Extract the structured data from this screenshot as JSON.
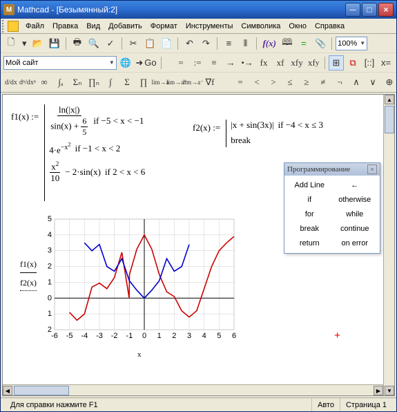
{
  "title": "Mathcad - [Безымянный:2]",
  "menu": [
    "Файл",
    "Правка",
    "Вид",
    "Добавить",
    "Формат",
    "Инструменты",
    "Символика",
    "Окно",
    "Справка"
  ],
  "toolbar2": {
    "site_label": "Мой сайт",
    "go": "Go"
  },
  "zoom": "100%",
  "status": {
    "hint": "Для справки нажмите F1",
    "mode": "Авто",
    "page": "Страница 1"
  },
  "programming": {
    "title": "Программирование",
    "items": [
      "Add Line",
      "←",
      "if",
      "otherwise",
      "for",
      "while",
      "break",
      "continue",
      "return",
      "on error"
    ]
  },
  "formulas": {
    "f1_lhs": "f1(x) :=",
    "f1_r1_num": "ln(|x|)",
    "f1_r1_den_a": "sin(x) + ",
    "f1_r1_den_frac_num": "6",
    "f1_r1_den_frac_den": "5",
    "f1_r1_cond": "if  −5 < x < −1",
    "f1_r2_a": "4·e",
    "f1_r2_exp": "−x",
    "f1_r2_exp2": "2",
    "f1_r2_cond": "if  −1 < x < 2",
    "f1_r3_frac_num": "x",
    "f1_r3_frac_num_exp": "2",
    "f1_r3_frac_den": "10",
    "f1_r3_b": " − 2·sin(x)",
    "f1_r3_cond": "if  2 < x < 6",
    "f2_lhs": "f2(x) :=",
    "f2_r1": "|x + sin(3x)|",
    "f2_r1_cond": "if  −4 < x ≤ 3",
    "f2_r2": "break",
    "plot_y1": "f1(x)",
    "plot_y2": "f2(x)",
    "plot_x": "x"
  },
  "chart_data": {
    "type": "line",
    "xlabel": "x",
    "ylabel": "",
    "xlim": [
      -6,
      6
    ],
    "ylim": [
      -2,
      5
    ],
    "xticks": [
      -6,
      -5,
      -4,
      -3,
      -2,
      -1,
      0,
      1,
      2,
      3,
      4,
      5,
      6
    ],
    "yticks": [
      -2,
      -1,
      0,
      1,
      2,
      3,
      4,
      5
    ],
    "series": [
      {
        "name": "f1(x)",
        "color": "#cc0000",
        "x": [
          -5,
          -4.5,
          -4,
          -3.5,
          -3,
          -2.5,
          -2,
          -1.5,
          -1.01,
          -0.99,
          -0.5,
          0,
          0.5,
          1,
          1.5,
          2,
          2.5,
          3,
          3.5,
          4,
          4.5,
          5,
          5.5,
          6
        ],
        "y": [
          -0.9,
          -1.4,
          -1.0,
          0.7,
          0.95,
          0.6,
          1.3,
          2.9,
          0.0,
          1.5,
          3.1,
          4.0,
          3.1,
          1.5,
          0.4,
          0.1,
          -0.8,
          -1.2,
          -0.8,
          0.6,
          2.0,
          3.0,
          3.5,
          3.9
        ]
      },
      {
        "name": "f2(x)",
        "color": "#0000cc",
        "x": [
          -4,
          -3.5,
          -3,
          -2.5,
          -2,
          -1.5,
          -1,
          -0.5,
          0,
          0.5,
          1,
          1.5,
          2,
          2.5,
          3
        ],
        "y": [
          3.5,
          3.0,
          3.4,
          2.0,
          1.7,
          2.5,
          1.1,
          0.5,
          0.0,
          0.5,
          1.1,
          2.5,
          1.7,
          2.0,
          3.4
        ]
      }
    ]
  }
}
